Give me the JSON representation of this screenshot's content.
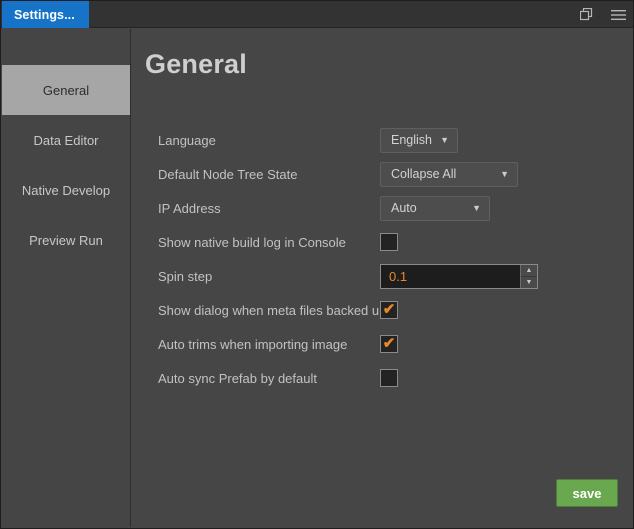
{
  "titlebar": {
    "tab_label": "Settings...",
    "restore_icon": "restore-window-icon",
    "menu_icon": "hamburger-menu-icon"
  },
  "sidebar": {
    "items": [
      {
        "label": "General",
        "active": true
      },
      {
        "label": "Data Editor",
        "active": false
      },
      {
        "label": "Native Develop",
        "active": false
      },
      {
        "label": "Preview Run",
        "active": false
      }
    ]
  },
  "main": {
    "title": "General",
    "rows": [
      {
        "label": "Language",
        "value": "English"
      },
      {
        "label": "Default Node Tree State",
        "value": "Collapse All"
      },
      {
        "label": "IP Address",
        "value": "Auto"
      },
      {
        "label": "Show native build log in Console",
        "checked": ""
      },
      {
        "label": "Spin step",
        "value": "0.1"
      },
      {
        "label": "Show dialog when meta files backed up.",
        "checked": "✔"
      },
      {
        "label": "Auto trims when importing image",
        "checked": "✔"
      },
      {
        "label": "Auto sync Prefab by default",
        "checked": ""
      }
    ],
    "caret": "▼",
    "spin_up": "▲",
    "spin_down": "▼",
    "save_label": "save"
  },
  "colors": {
    "tab_accent": "#1673c7",
    "check_orange": "#e8882a",
    "save_green": "#6aa84f",
    "panel_bg": "#464646",
    "sidebar_bg": "#454545"
  }
}
